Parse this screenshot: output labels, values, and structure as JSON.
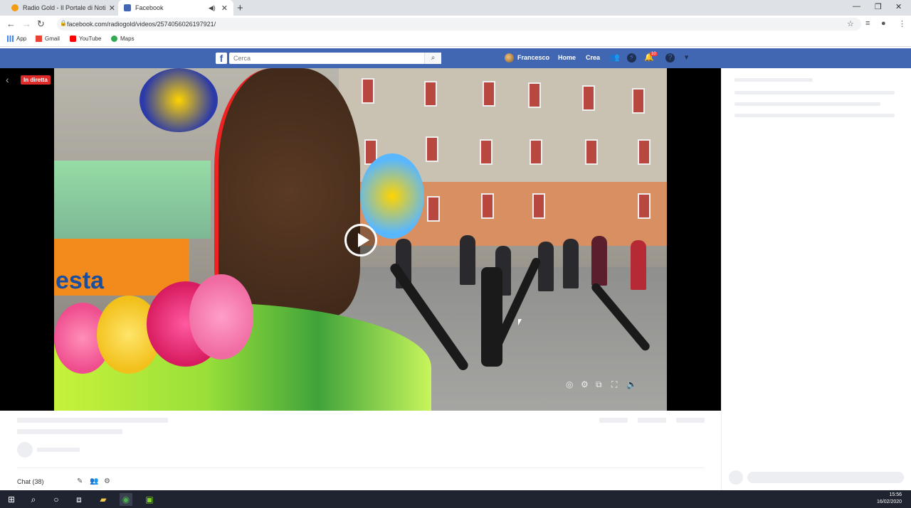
{
  "browser": {
    "tabs": [
      {
        "title": "Radio Gold - Il Portale di Notizie",
        "active": false
      },
      {
        "title": "Facebook",
        "active": true
      }
    ],
    "url": "facebook.com/radiogold/videos/2574056026197921/",
    "bookmarks": [
      "App",
      "Gmail",
      "YouTube",
      "Maps"
    ]
  },
  "facebook": {
    "search_placeholder": "Cerca",
    "user": "Francesco",
    "nav": [
      "Home",
      "Crea"
    ],
    "notification_count": "10"
  },
  "video": {
    "live_badge": "In diretta",
    "sign_text": "esta"
  },
  "chat": {
    "label": "Chat (38)"
  },
  "taskbar": {
    "time": "15:56",
    "date": "16/02/2020"
  },
  "colors": {
    "fb_blue": "#4267b2",
    "live_red": "#e02b2b",
    "tab_strip": "#dee1e6"
  }
}
